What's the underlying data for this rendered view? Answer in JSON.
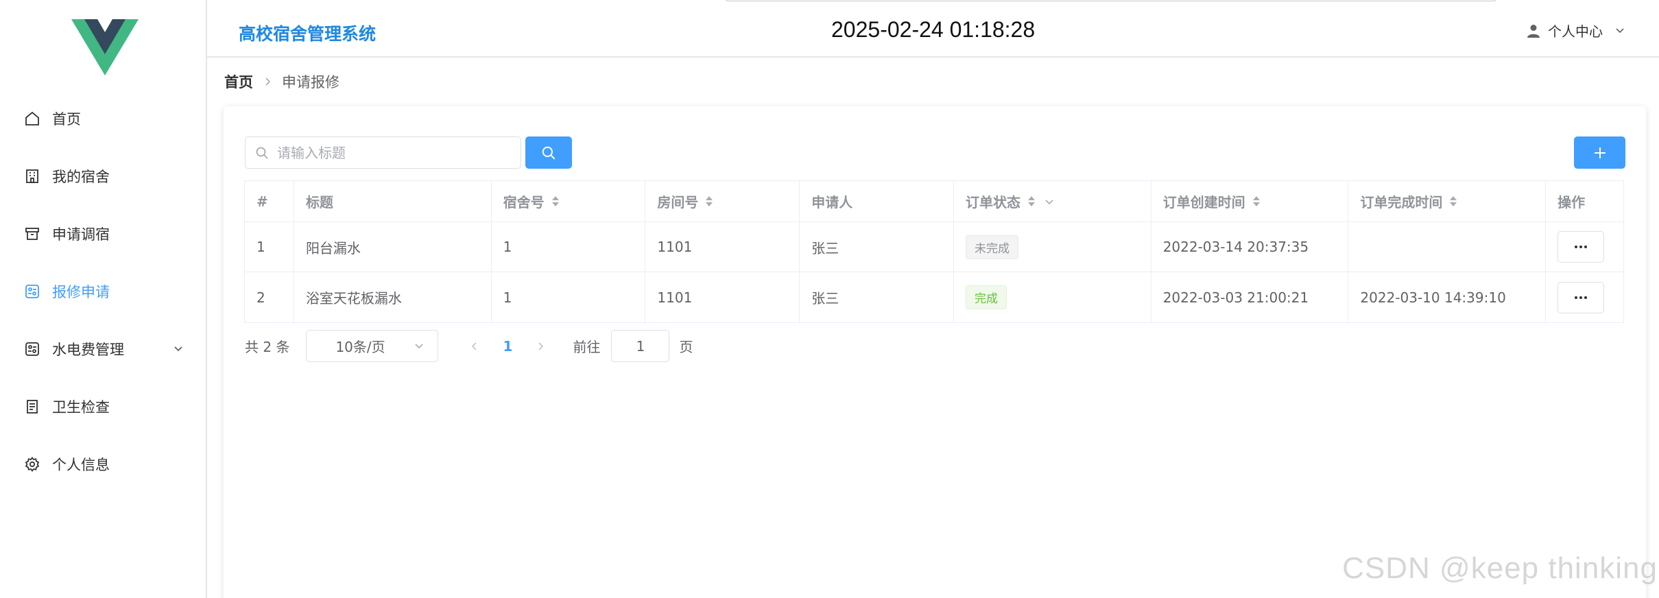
{
  "app": {
    "title": "高校宿舍管理系统",
    "clock": "2025-02-24 01:18:28",
    "user_center_label": "个人中心",
    "accent_color": "#409eff"
  },
  "sidebar": {
    "items": [
      {
        "label": "首页",
        "icon": "home-icon",
        "active": false
      },
      {
        "label": "我的宿舍",
        "icon": "building-icon",
        "active": false
      },
      {
        "label": "申请调宿",
        "icon": "box-icon",
        "active": false
      },
      {
        "label": "报修申请",
        "icon": "repair-icon",
        "active": true
      },
      {
        "label": "水电费管理",
        "icon": "utility-icon",
        "active": false,
        "expandable": true
      },
      {
        "label": "卫生检查",
        "icon": "document-icon",
        "active": false
      },
      {
        "label": "个人信息",
        "icon": "gear-icon",
        "active": false
      }
    ]
  },
  "breadcrumb": {
    "home": "首页",
    "current": "申请报修"
  },
  "toolbar": {
    "search_placeholder": "请输入标题",
    "search_value": ""
  },
  "table": {
    "columns": [
      "#",
      "标题",
      "宿舍号",
      "房间号",
      "申请人",
      "订单状态",
      "订单创建时间",
      "订单完成时间",
      "操作"
    ],
    "rows": [
      {
        "index": "1",
        "title": "阳台漏水",
        "dorm": "1",
        "room": "1101",
        "applicant": "张三",
        "status": "未完成",
        "status_color": "grey",
        "created": "2022-03-14 20:37:35",
        "finished": ""
      },
      {
        "index": "2",
        "title": "浴室天花板漏水",
        "dorm": "1",
        "room": "1101",
        "applicant": "张三",
        "status": "完成",
        "status_color": "green",
        "created": "2022-03-03 21:00:21",
        "finished": "2022-03-10 14:39:10"
      }
    ]
  },
  "pagination": {
    "total_text": "共 2 条",
    "page_size": "10条/页",
    "current_page": "1",
    "goto_label": "前往",
    "goto_value": "1",
    "page_suffix": "页"
  },
  "watermark": "CSDN @keep   thinking"
}
